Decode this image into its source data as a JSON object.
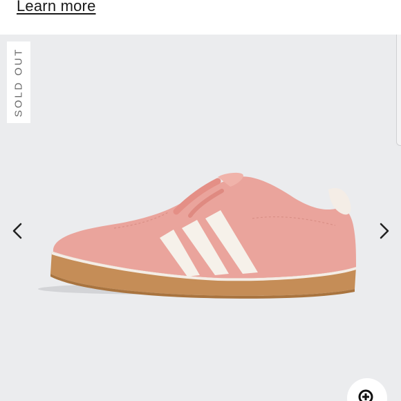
{
  "header": {
    "learn_more_label": "Learn more"
  },
  "gallery": {
    "badge_label": "SOLD OUT",
    "prev_icon": "chevron-left-icon",
    "next_icon": "chevron-right-icon",
    "zoom_icon": "zoom-in-icon",
    "colors": {
      "background": "#ebecee",
      "shoe_upper": "#eaa49c",
      "stripes": "#f6f1ea",
      "sole": "#c8925a"
    }
  }
}
